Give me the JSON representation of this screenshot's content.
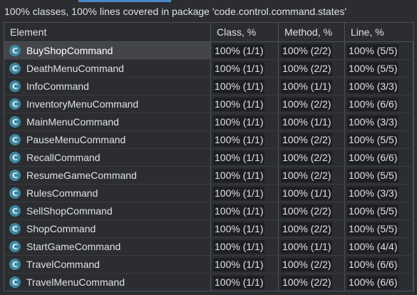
{
  "summary": "100% classes, 100% lines covered in package 'code.control.command.states'",
  "columns": {
    "element": "Element",
    "class": "Class, %",
    "method": "Method, %",
    "line": "Line, %"
  },
  "icon_letter": "C",
  "rows": [
    {
      "name": "BuyShopCommand",
      "class": "100% (1/1)",
      "method": "100% (2/2)",
      "line": "100% (5/5)",
      "selected": true
    },
    {
      "name": "DeathMenuCommand",
      "class": "100% (1/1)",
      "method": "100% (2/2)",
      "line": "100% (5/5)"
    },
    {
      "name": "InfoCommand",
      "class": "100% (1/1)",
      "method": "100% (1/1)",
      "line": "100% (3/3)"
    },
    {
      "name": "InventoryMenuCommand",
      "class": "100% (1/1)",
      "method": "100% (2/2)",
      "line": "100% (6/6)"
    },
    {
      "name": "MainMenuCommand",
      "class": "100% (1/1)",
      "method": "100% (1/1)",
      "line": "100% (3/3)"
    },
    {
      "name": "PauseMenuCommand",
      "class": "100% (1/1)",
      "method": "100% (2/2)",
      "line": "100% (5/5)"
    },
    {
      "name": "RecallCommand",
      "class": "100% (1/1)",
      "method": "100% (2/2)",
      "line": "100% (6/6)"
    },
    {
      "name": "ResumeGameCommand",
      "class": "100% (1/1)",
      "method": "100% (2/2)",
      "line": "100% (5/5)"
    },
    {
      "name": "RulesCommand",
      "class": "100% (1/1)",
      "method": "100% (1/1)",
      "line": "100% (3/3)"
    },
    {
      "name": "SellShopCommand",
      "class": "100% (1/1)",
      "method": "100% (2/2)",
      "line": "100% (5/5)"
    },
    {
      "name": "ShopCommand",
      "class": "100% (1/1)",
      "method": "100% (2/2)",
      "line": "100% (5/5)"
    },
    {
      "name": "StartGameCommand",
      "class": "100% (1/1)",
      "method": "100% (1/1)",
      "line": "100% (4/4)"
    },
    {
      "name": "TravelCommand",
      "class": "100% (1/1)",
      "method": "100% (2/2)",
      "line": "100% (6/6)"
    },
    {
      "name": "TravelMenuCommand",
      "class": "100% (1/1)",
      "method": "100% (2/2)",
      "line": "100% (6/6)"
    }
  ],
  "colors": {
    "background": "#2b2d30",
    "selection": "#43454a",
    "class_icon": "#3e86a0",
    "tab_accent": "#4a88c7"
  }
}
